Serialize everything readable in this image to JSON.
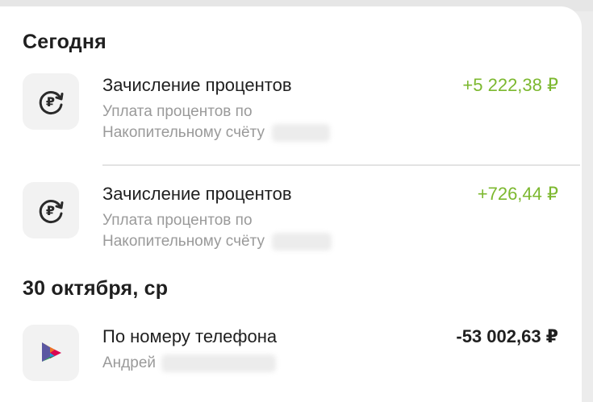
{
  "colors": {
    "income": "#7cb82f",
    "expense": "#1f1f1f",
    "card_bg": "#ffffff",
    "icon_bg": "#f2f2f2",
    "muted_text": "#9a9a9a"
  },
  "sections": [
    {
      "title": "Сегодня",
      "operations": [
        {
          "icon": "ruble-interest-icon",
          "title": "Зачисление процентов",
          "desc_line1": "Уплата процентов по",
          "desc_line2": "Накопительному счёту",
          "amount": "+5 222,38 ₽"
        },
        {
          "icon": "ruble-interest-icon",
          "title": "Зачисление процентов",
          "desc_line1": "Уплата процентов по",
          "desc_line2": "Накопительному счёту",
          "amount": "+726,44 ₽"
        }
      ]
    },
    {
      "title": "30 октября, ср",
      "operations": [
        {
          "icon": "sbp-logo-icon",
          "title": "По номеру телефона",
          "desc_line1": "Андрей",
          "amount": "-53 002,63 ₽"
        }
      ]
    }
  ]
}
